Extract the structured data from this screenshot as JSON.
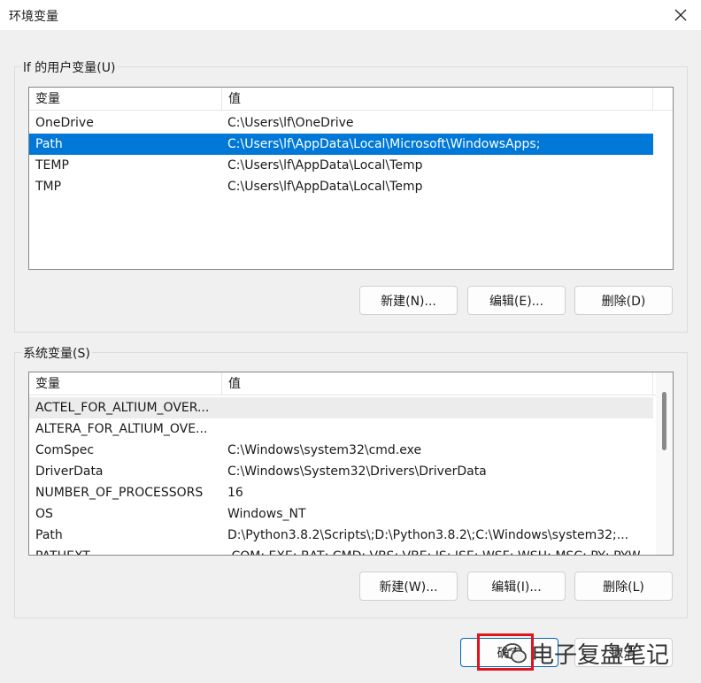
{
  "window": {
    "title": "环境变量",
    "close_icon": "close-icon"
  },
  "user_vars": {
    "group_label": "lf 的用户变量(U)",
    "columns": [
      "变量",
      "值"
    ],
    "rows": [
      {
        "name": "OneDrive",
        "value": "C:\\Users\\lf\\OneDrive"
      },
      {
        "name": "Path",
        "value": "C:\\Users\\lf\\AppData\\Local\\Microsoft\\WindowsApps;"
      },
      {
        "name": "TEMP",
        "value": "C:\\Users\\lf\\AppData\\Local\\Temp"
      },
      {
        "name": "TMP",
        "value": "C:\\Users\\lf\\AppData\\Local\\Temp"
      }
    ],
    "selected_row": "Path",
    "buttons": {
      "new": "新建(N)...",
      "edit": "编辑(E)...",
      "delete": "删除(D)"
    }
  },
  "system_vars": {
    "group_label": "系统变量(S)",
    "columns": [
      "变量",
      "值"
    ],
    "rows": [
      {
        "name": "ACTEL_FOR_ALTIUM_OVER...",
        "value": ""
      },
      {
        "name": "ALTERA_FOR_ALTIUM_OVE...",
        "value": ""
      },
      {
        "name": "ComSpec",
        "value": "C:\\Windows\\system32\\cmd.exe"
      },
      {
        "name": "DriverData",
        "value": "C:\\Windows\\System32\\Drivers\\DriverData"
      },
      {
        "name": "NUMBER_OF_PROCESSORS",
        "value": "16"
      },
      {
        "name": "OS",
        "value": "Windows_NT"
      },
      {
        "name": "Path",
        "value": "D:\\Python3.8.2\\Scripts\\;D:\\Python3.8.2\\;C:\\Windows\\system32;..."
      },
      {
        "name": "PATHEXT",
        "value": ".COM;.EXE;.BAT;.CMD;.VBS;.VBE;.JS;.JSE;.WSF;.WSH;.MSC;.PY;.PYW"
      }
    ],
    "hovered_row": "ACTEL_FOR_ALTIUM_OVER...",
    "buttons": {
      "new": "新建(W)...",
      "edit": "编辑(I)...",
      "delete": "删除(L)"
    }
  },
  "footer": {
    "ok": "确定",
    "cancel": "取消"
  },
  "watermark": {
    "text": "电子复盘笔记",
    "icon": "wechat-icon"
  },
  "colors": {
    "selection": "#0078d7",
    "highlight_box": "#e0141c"
  }
}
